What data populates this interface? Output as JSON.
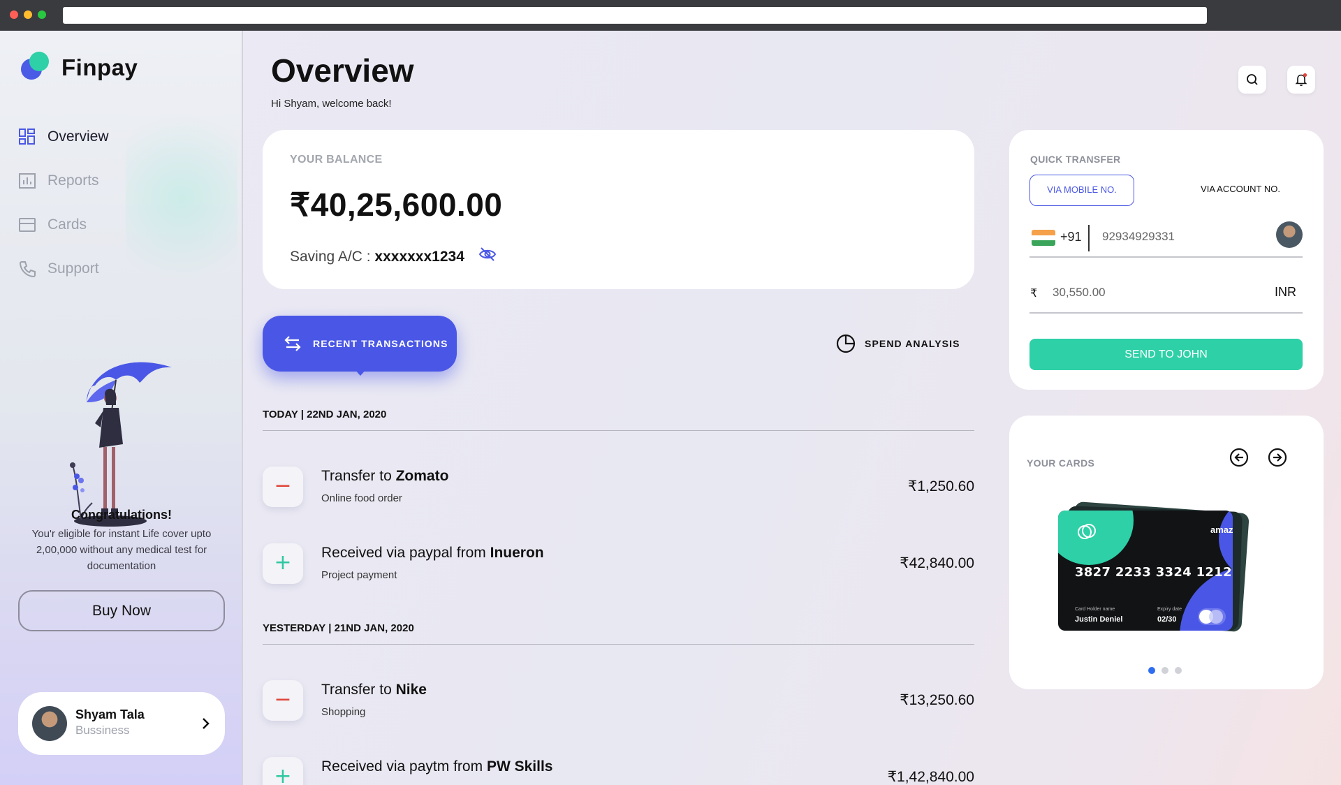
{
  "brand": {
    "name": "Finpay"
  },
  "sidebar": {
    "items": [
      {
        "label": "Overview",
        "icon": "grid-icon",
        "active": true
      },
      {
        "label": "Reports",
        "icon": "chart-icon",
        "active": false
      },
      {
        "label": "Cards",
        "icon": "card-icon",
        "active": false
      },
      {
        "label": "Support",
        "icon": "phone-icon",
        "active": false
      }
    ],
    "promo": {
      "title": "Congratulations!",
      "text": "You'r eligible for instant Life cover upto 2,00,000 without any medical test for documentation",
      "button": "Buy Now"
    },
    "profile": {
      "name": "Shyam Tala",
      "role": "Bussiness"
    }
  },
  "header": {
    "title": "Overview",
    "subtitle": "Hi Shyam, welcome back!"
  },
  "balance": {
    "label": "YOUR BALANCE",
    "amount": "₹40,25,600.00",
    "account_prefix": "Saving A/C :",
    "account_number": "xxxxxxx1234"
  },
  "tabs": {
    "recent": "RECENT TRANSACTIONS",
    "spend": "SPEND ANALYSIS"
  },
  "groups": [
    {
      "date": "TODAY | 22ND JAN, 2020",
      "transactions": [
        {
          "type": "debit",
          "sign": "−",
          "prefix": "Transfer to",
          "party": "Zomato",
          "note": "Online food order",
          "amount": "₹1,250.60"
        },
        {
          "type": "credit",
          "sign": "+",
          "prefix": "Received via paypal from",
          "party": "Inueron",
          "note": "Project payment",
          "amount": "₹42,840.00"
        }
      ]
    },
    {
      "date": "YESTERDAY | 21ND JAN, 2020",
      "transactions": [
        {
          "type": "debit",
          "sign": "−",
          "prefix": "Transfer to",
          "party": "Nike",
          "note": "Shopping",
          "amount": "₹13,250.60"
        },
        {
          "type": "credit",
          "sign": "+",
          "prefix": "Received via paytm from",
          "party": "PW Skills",
          "note": "",
          "amount": "₹1,42,840.00"
        }
      ]
    }
  ],
  "quick_transfer": {
    "label": "QUICK TRANSFER",
    "tab_mobile": "VIA MOBILE NO.",
    "tab_account": "VIA ACCOUNT NO.",
    "country_code": "+91",
    "phone_value": "92934929331",
    "currency_symbol": "₹",
    "amount_value": "30,550.00",
    "currency": "INR",
    "send_label": "SEND TO JOHN"
  },
  "cards": {
    "label": "YOUR CARDS",
    "card": {
      "brand": "amazon",
      "number": "3827 2233 3324 1212",
      "holder_label": "Card Holder name",
      "holder": "Justin Deniel",
      "expiry_label": "Expiry date",
      "expiry": "02/30"
    },
    "pages": 3,
    "active_page": 1
  },
  "colors": {
    "accent": "#4a57e6",
    "teal": "#2ed0a7",
    "debit": "#e0463a",
    "credit": "#2ec8a0"
  }
}
